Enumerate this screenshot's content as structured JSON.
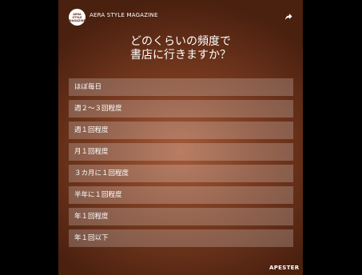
{
  "header": {
    "logo_text": "AERA STYLE MAGAZINE",
    "brand": "AERA STYLE MAGAZINE",
    "share_icon": "share-icon"
  },
  "question": {
    "line1": "どのくらいの頻度で",
    "line2": "書店に行きますか？"
  },
  "options": [
    "ほぼ毎日",
    "週２〜３回程度",
    "週１回程度",
    "月１回程度",
    "３カ月に１回程度",
    "半年に１回程度",
    "年１回程度",
    "年１回以下"
  ],
  "footer": {
    "brand": "APESTER"
  },
  "colors": {
    "background": "#000000",
    "card_center": "#a55a39",
    "card_edge": "#4a200f",
    "option_bg": "rgba(255,255,255,0.22)"
  }
}
